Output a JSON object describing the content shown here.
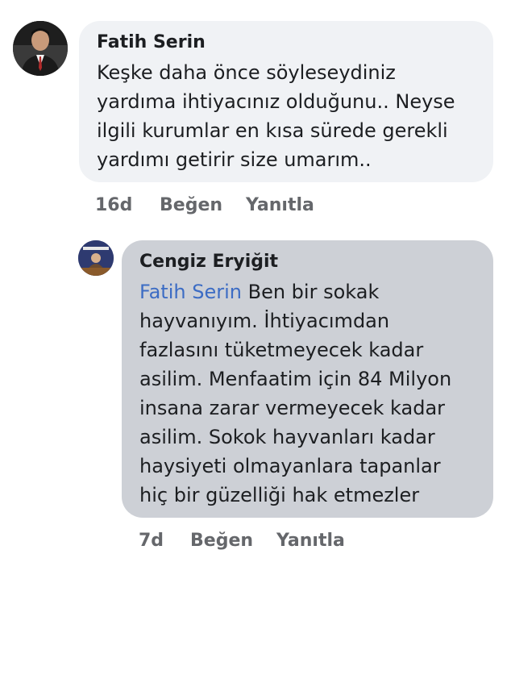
{
  "comments": [
    {
      "author": "Fatih Serin",
      "text_lines": [
        "Keşke daha önce söyleseydiniz",
        "yardıma ihtiyacınız olduğunu.. Neyse",
        "ilgili kurumlar en kısa sürede gerekli",
        "yardımı getirir size umarım.."
      ],
      "time": "16d",
      "like_label": "Beğen",
      "reply_label": "Yanıtla",
      "bubble_color": "#f0f2f5"
    },
    {
      "author": "Cengiz Eryiğit",
      "mention": "Fatih Serin",
      "first_line_rest": " Ben bir sokak",
      "text_lines": [
        "hayvanıyım. İhtiyacımdan",
        "fazlasını tüketmeyecek kadar",
        "asilim. Menfaatim için 84 Milyon",
        "insana zarar vermeyecek kadar",
        "asilim. Sokok hayvanları kadar",
        "haysiyeti olmayanlara tapanlar",
        "hiç bir güzelliği hak etmezler"
      ],
      "time": "7d",
      "like_label": "Beğen",
      "reply_label": "Yanıtla",
      "bubble_color": "#cdd0d6"
    }
  ]
}
